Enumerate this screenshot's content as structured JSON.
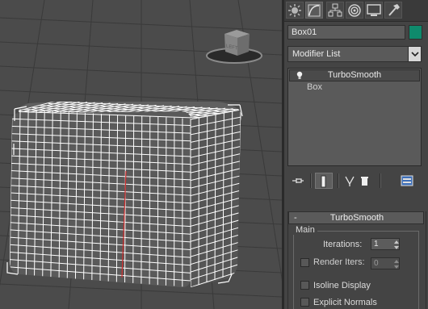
{
  "command_tabs": [
    {
      "icon": "sun-icon",
      "active": false
    },
    {
      "icon": "curve-modify-icon",
      "active": true
    },
    {
      "icon": "hierarchy-icon",
      "active": false
    },
    {
      "icon": "motion-icon",
      "active": false
    },
    {
      "icon": "display-icon",
      "active": false
    },
    {
      "icon": "hammer-utilities-icon",
      "active": false
    }
  ],
  "object": {
    "name": "Box01",
    "color": "#0f8a6c"
  },
  "modifier_list": {
    "label": "Modifier List"
  },
  "stack": {
    "items": [
      {
        "label": "TurboSmooth",
        "selected": true
      },
      {
        "label": "Box",
        "selected": false
      }
    ]
  },
  "stack_tools": [
    "pin-stack-icon",
    "show-end-result-icon",
    "make-unique-icon",
    "remove-modifier-icon",
    "configure-sets-icon"
  ],
  "rollout": {
    "collapse": "-",
    "title": "TurboSmooth",
    "group": "Main",
    "iterations_label": "Iterations:",
    "iterations_value": "1",
    "render_iters_label": "Render Iters:",
    "render_iters_value": "0",
    "isoline_label": "Isoline Display",
    "explicit_normals_label": "Explicit Normals"
  },
  "viewcube": {
    "face_label": "LEFT"
  }
}
